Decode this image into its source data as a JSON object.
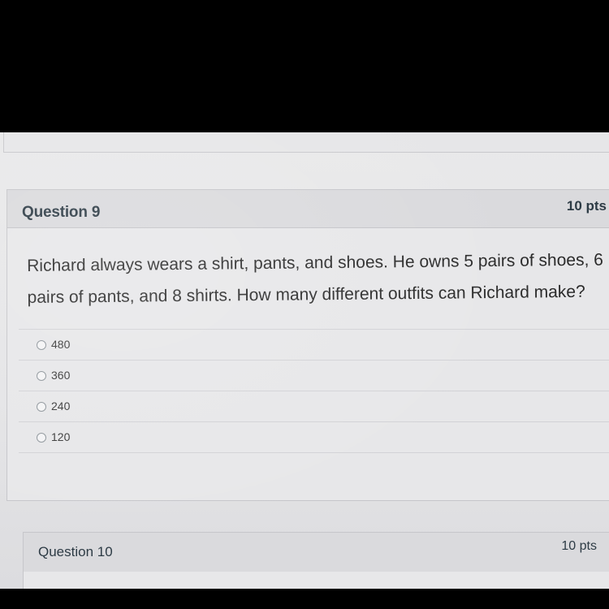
{
  "question9": {
    "title": "Question 9",
    "points": "10 pts",
    "text": "Richard always wears a shirt, pants, and shoes.  He owns 5 pairs of shoes, 6 pairs of pants, and 8 shirts.  How many different outfits can Richard make?",
    "answers": [
      {
        "label": "480",
        "selected": false
      },
      {
        "label": "360",
        "selected": false
      },
      {
        "label": "240",
        "selected": false
      },
      {
        "label": "120",
        "selected": false
      }
    ]
  },
  "question10": {
    "title": "Question 10",
    "points": "10 pts"
  }
}
